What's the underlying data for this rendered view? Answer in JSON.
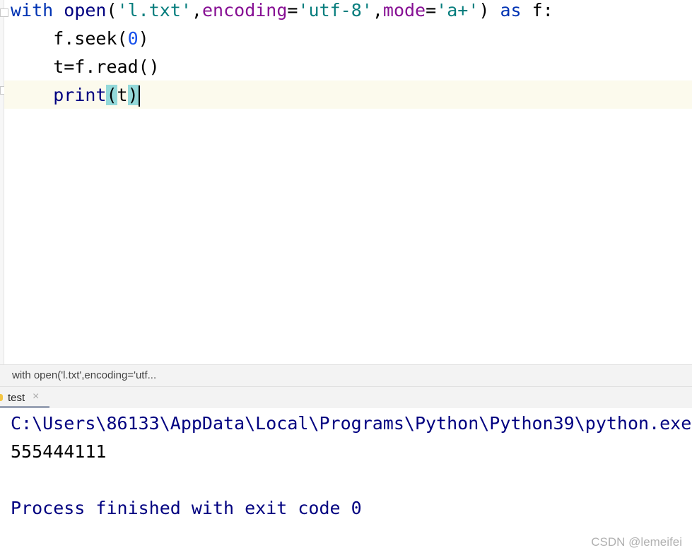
{
  "editor": {
    "lines": [
      {
        "tokens": [
          [
            "kw",
            "with"
          ],
          [
            "",
            "​ "
          ],
          [
            "fn",
            "open"
          ],
          [
            "",
            "("
          ],
          [
            "str",
            "'l.txt'"
          ],
          [
            "",
            ","
          ],
          [
            "param",
            "encoding"
          ],
          [
            "",
            "="
          ],
          [
            "str",
            "'utf-8'"
          ],
          [
            "",
            ","
          ],
          [
            "param",
            "mode"
          ],
          [
            "",
            "="
          ],
          [
            "str",
            "'a+'"
          ],
          [
            "",
            ") "
          ],
          [
            "kw",
            "as"
          ],
          [
            "",
            " f:"
          ]
        ]
      },
      {
        "tokens": [
          [
            "",
            "    f.seek("
          ],
          [
            "num",
            "0"
          ],
          [
            "",
            ")"
          ]
        ]
      },
      {
        "tokens": [
          [
            "",
            "    t=f.read()"
          ]
        ]
      },
      {
        "tokens": [
          [
            "",
            "    "
          ],
          [
            "fn",
            "print"
          ],
          [
            "br",
            "("
          ],
          [
            "",
            "t"
          ],
          [
            "br",
            ")"
          ]
        ]
      }
    ]
  },
  "breadcrumb": {
    "text": "with open('l.txt',encoding='utf..."
  },
  "run_tab": {
    "label": "test",
    "close": "×"
  },
  "console": {
    "command": "C:\\Users\\86133\\AppData\\Local\\Programs\\Python\\Python39\\python.exe",
    "output": "555444111",
    "exit": "Process finished with exit code 0"
  },
  "watermark": "CSDN @lemeifei"
}
